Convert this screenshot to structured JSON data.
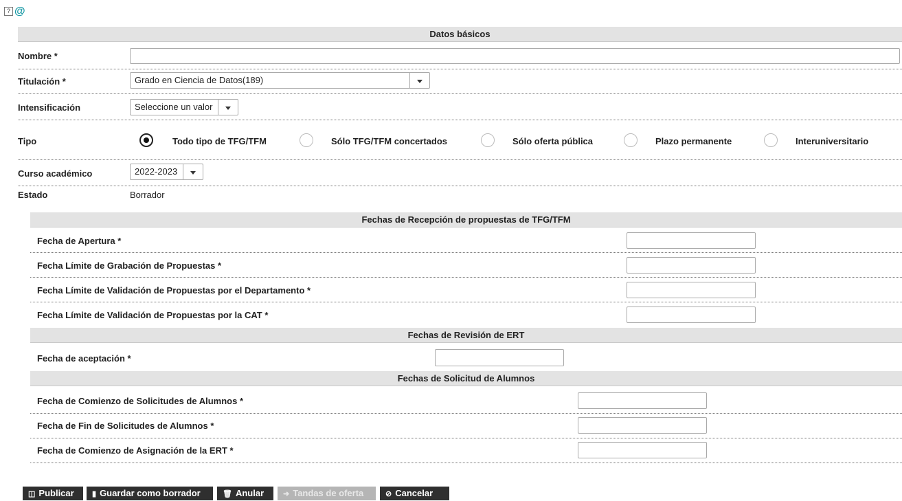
{
  "icons": {
    "help": "?",
    "at": "@"
  },
  "datos_basicos": {
    "header": "Datos básicos",
    "nombre_label": "Nombre *",
    "nombre_value": "",
    "titulacion_label": "Titulación *",
    "titulacion_value": "Grado en Ciencia de Datos(189)",
    "intensificacion_label": "Intensificación",
    "intensificacion_value": "Seleccione un valor",
    "tipo_label": "Tipo",
    "tipo_options": [
      "Todo tipo de TFG/TFM",
      "Sólo TFG/TFM concertados",
      "Sólo oferta pública",
      "Plazo permanente",
      "Interuniversitario"
    ],
    "tipo_selected": 0,
    "curso_label": "Curso académico",
    "curso_value": "2022-2023",
    "estado_label": "Estado",
    "estado_value": "Borrador"
  },
  "recepcion": {
    "header": "Fechas de Recepción de propuestas de TFG/TFM",
    "fields": [
      "Fecha de Apertura *",
      "Fecha Límite de Grabación de Propuestas *",
      "Fecha Límite de Validación de Propuestas por el Departamento *",
      "Fecha Límite de Validación de Propuestas por la CAT *"
    ]
  },
  "revision": {
    "header": "Fechas de Revisión de ERT",
    "fields": [
      "Fecha de aceptación *"
    ]
  },
  "solicitud": {
    "header": "Fechas de Solicitud de Alumnos",
    "fields": [
      "Fecha de Comienzo de Solicitudes de Alumnos *",
      "Fecha de Fin de Solicitudes de Alumnos *",
      "Fecha de Comienzo de Asignación de la ERT *"
    ]
  },
  "buttons": {
    "publicar": "Publicar",
    "guardar": "Guardar como borrador",
    "anular": "Anular",
    "tandas": "Tandas de oferta",
    "cancelar": "Cancelar"
  }
}
